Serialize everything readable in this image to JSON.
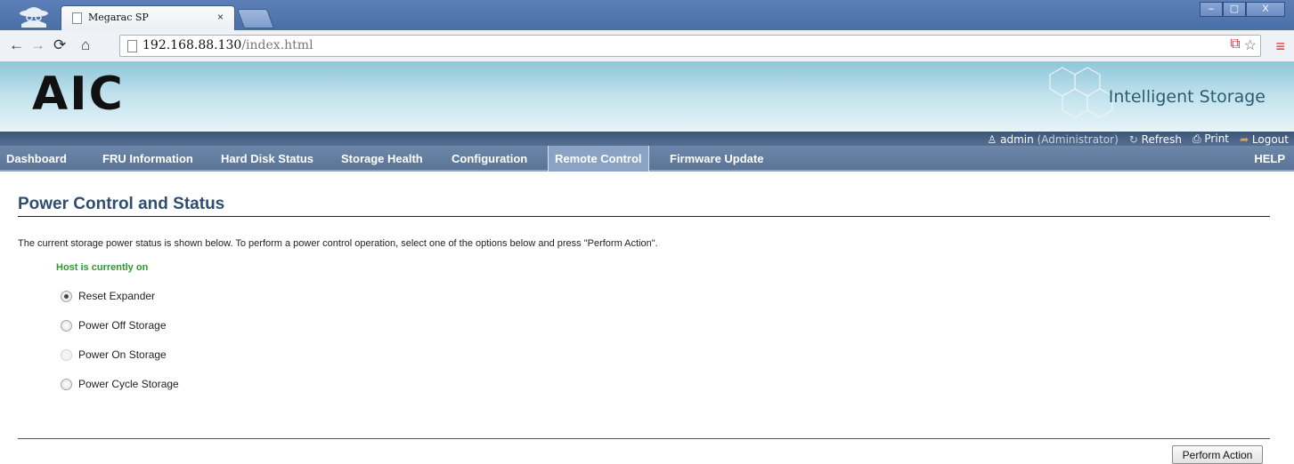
{
  "browser": {
    "tab_title": "Megarac SP",
    "tab_close": "×",
    "url_host": "192.168.88.130",
    "url_path": "/index.html",
    "window_buttons": {
      "minimize": "–",
      "maximize": "▢",
      "close": "X"
    }
  },
  "header": {
    "logo": "AIC",
    "brand": "Intelligent Storage",
    "user": "admin",
    "role": "(Administrator)",
    "refresh": "Refresh",
    "print": "Print",
    "logout": "Logout"
  },
  "nav": {
    "items": [
      {
        "label": "Dashboard"
      },
      {
        "label": "FRU Information"
      },
      {
        "label": "Hard Disk Status"
      },
      {
        "label": "Storage Health"
      },
      {
        "label": "Configuration"
      },
      {
        "label": "Remote Control"
      },
      {
        "label": "Firmware Update"
      }
    ],
    "active": "Remote Control",
    "help": "HELP"
  },
  "content": {
    "title": "Power Control and Status",
    "description": "The current storage power status is shown below. To perform a power control operation, select one of the options below and press \"Perform Action\".",
    "status": "Host is currently on",
    "options": [
      {
        "label": "Reset Expander",
        "checked": true,
        "disabled": false
      },
      {
        "label": "Power Off Storage",
        "checked": false,
        "disabled": false
      },
      {
        "label": "Power On Storage",
        "checked": false,
        "disabled": true
      },
      {
        "label": "Power Cycle Storage",
        "checked": false,
        "disabled": false
      }
    ],
    "action_button": "Perform Action"
  },
  "colors": {
    "nav_bg": "#5a7498",
    "nav_active": "#8aa2c3",
    "title": "#2f4e6f",
    "status_green": "#2c9a2c"
  },
  "icons": [
    "incognito-icon",
    "page-icon",
    "back-icon",
    "forward-icon",
    "reload-icon",
    "home-icon",
    "popup-blocked-icon",
    "star-icon",
    "menu-icon",
    "user-icon",
    "refresh-icon",
    "print-icon",
    "logout-icon"
  ]
}
